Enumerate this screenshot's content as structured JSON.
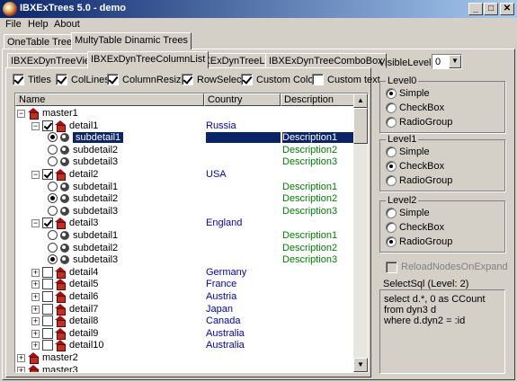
{
  "window": {
    "title": "IBXExTrees 5.0 - demo",
    "minimize": "_",
    "maximize": "□",
    "close": "✕"
  },
  "menu": [
    "File",
    "Help",
    "About"
  ],
  "outer_tabs": [
    "OneTable Trees",
    "MultyTable Dinamic Trees"
  ],
  "inner_tabs": [
    "IBXExDynTreeView",
    "IBXExDynTreeColumnList",
    "IBXExDynTreeList",
    "IBXExDynTreeComboBox"
  ],
  "options": [
    {
      "label": "Titles",
      "checked": true
    },
    {
      "label": "ColLines",
      "checked": true
    },
    {
      "label": "ColumnResize",
      "checked": true
    },
    {
      "label": "RowSelect",
      "checked": true
    },
    {
      "label": "Custom Color",
      "checked": true
    },
    {
      "label": "Custom text",
      "checked": false
    }
  ],
  "columns": [
    "Name",
    "Country",
    "Description"
  ],
  "rows": [
    {
      "level": 0,
      "type": "master",
      "name": "master1",
      "country": "",
      "desc": "",
      "expanded": true
    },
    {
      "level": 1,
      "type": "detail",
      "name": "detail1",
      "country": "Russia",
      "desc": "",
      "checked": true,
      "expanded": true
    },
    {
      "level": 2,
      "type": "subdetail",
      "name": "subdetail1",
      "country": "",
      "desc": "Description1",
      "radio": true,
      "selected": true
    },
    {
      "level": 2,
      "type": "subdetail",
      "name": "subdetail2",
      "country": "",
      "desc": "Description2",
      "radio": false
    },
    {
      "level": 2,
      "type": "subdetail",
      "name": "subdetail3",
      "country": "",
      "desc": "Description3",
      "radio": false
    },
    {
      "level": 1,
      "type": "detail",
      "name": "detail2",
      "country": "USA",
      "desc": "",
      "checked": true,
      "expanded": true
    },
    {
      "level": 2,
      "type": "subdetail",
      "name": "subdetail1",
      "country": "",
      "desc": "Description1",
      "radio": false
    },
    {
      "level": 2,
      "type": "subdetail",
      "name": "subdetail2",
      "country": "",
      "desc": "Description2",
      "radio": true
    },
    {
      "level": 2,
      "type": "subdetail",
      "name": "subdetail3",
      "country": "",
      "desc": "Description3",
      "radio": false
    },
    {
      "level": 1,
      "type": "detail",
      "name": "detail3",
      "country": "England",
      "desc": "",
      "checked": true,
      "expanded": true
    },
    {
      "level": 2,
      "type": "subdetail",
      "name": "subdetail1",
      "country": "",
      "desc": "Description1",
      "radio": false
    },
    {
      "level": 2,
      "type": "subdetail",
      "name": "subdetail2",
      "country": "",
      "desc": "Description2",
      "radio": false
    },
    {
      "level": 2,
      "type": "subdetail",
      "name": "subdetail3",
      "country": "",
      "desc": "Description3",
      "radio": true
    },
    {
      "level": 1,
      "type": "detail",
      "name": "detail4",
      "country": "Germany",
      "desc": "",
      "checked": false,
      "expanded": false
    },
    {
      "level": 1,
      "type": "detail",
      "name": "detail5",
      "country": "France",
      "desc": "",
      "checked": false,
      "expanded": false
    },
    {
      "level": 1,
      "type": "detail",
      "name": "detail6",
      "country": "Austria",
      "desc": "",
      "checked": false,
      "expanded": false
    },
    {
      "level": 1,
      "type": "detail",
      "name": "detail7",
      "country": "Japan",
      "desc": "",
      "checked": false,
      "expanded": false
    },
    {
      "level": 1,
      "type": "detail",
      "name": "detail8",
      "country": "Canada",
      "desc": "",
      "checked": false,
      "expanded": false
    },
    {
      "level": 1,
      "type": "detail",
      "name": "detail9",
      "country": "Australia",
      "desc": "",
      "checked": false,
      "expanded": false
    },
    {
      "level": 1,
      "type": "detail",
      "name": "detail10",
      "country": "Australia",
      "desc": "",
      "checked": false,
      "expanded": false
    },
    {
      "level": 0,
      "type": "master",
      "name": "master2",
      "country": "",
      "desc": "",
      "expanded": false
    },
    {
      "level": 0,
      "type": "master",
      "name": "master3",
      "country": "",
      "desc": "",
      "expanded": false
    }
  ],
  "visible_levels": {
    "label": "VisibleLevels",
    "value": "0"
  },
  "level_groups": [
    {
      "title": "Level0",
      "options": [
        "Simple",
        "CheckBox",
        "RadioGroup"
      ],
      "selected": 0
    },
    {
      "title": "Level1",
      "options": [
        "Simple",
        "CheckBox",
        "RadioGroup"
      ],
      "selected": 1
    },
    {
      "title": "Level2",
      "options": [
        "Simple",
        "CheckBox",
        "RadioGroup"
      ],
      "selected": 2
    }
  ],
  "reload": {
    "label": "ReloadNodesOnExpand",
    "checked": false
  },
  "select_sql": {
    "label": "SelectSql  (Level: 2)",
    "lines": [
      "select d.*, 0 as CCount",
      "from dyn3 d",
      "where d.dyn2 = :id"
    ]
  },
  "colors": {
    "titlebar": "#0a246a",
    "country": "#0000c0",
    "description": "#008000",
    "selection": "#0a246a"
  }
}
